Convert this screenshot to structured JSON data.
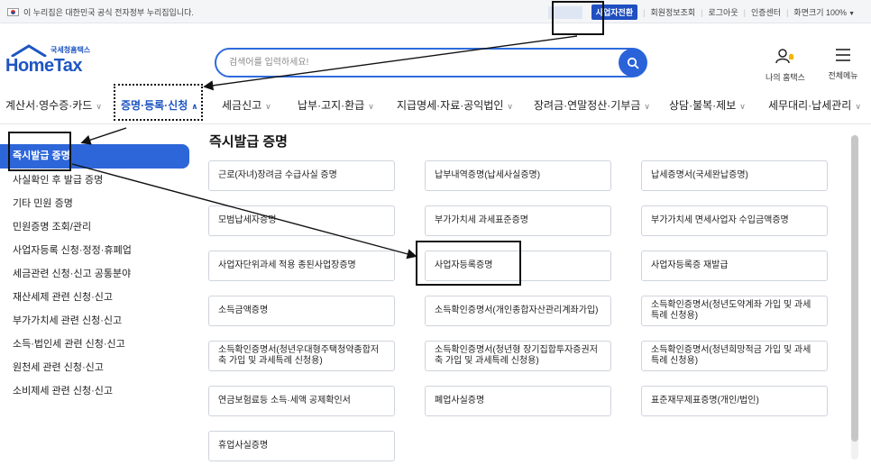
{
  "topbar": {
    "gov_notice": "이 누리집은 대한민국 공식 전자정부 누리집입니다.",
    "links": {
      "business": "사업자전환",
      "member_info": "회원정보조회",
      "logout": "로그아웃",
      "cert_center": "인증센터",
      "screen_size": "화면크기 100%"
    }
  },
  "header": {
    "logo_small": "국세청홈택스",
    "logo_big": "HomeTax",
    "search_placeholder": "검색어를 입력하세요!",
    "my_home": "나의 홈택스",
    "all_menu": "전체메뉴"
  },
  "nav": {
    "items": [
      "계산서·영수증·카드",
      "증명·등록·신청",
      "세금신고",
      "납부·고지·환급",
      "지급명세·자료·공익법인",
      "장려금·연말정산·기부금",
      "상담·불복·제보",
      "세무대리·납세관리"
    ]
  },
  "sidebar": {
    "items": [
      "즉시발급 증명",
      "사실확인 후 발급 증명",
      "기타 민원 증명",
      "민원증명 조회/관리",
      "사업자등록 신청·정정·휴폐업",
      "세금관련 신청·신고 공통분야",
      "재산세제 관련 신청·신고",
      "부가가치세 관련 신청·신고",
      "소득·법인세 관련 신청·신고",
      "원천세 관련 신청·신고",
      "소비제세 관련 신청·신고"
    ]
  },
  "main": {
    "title": "즉시발급 증명",
    "cards": [
      "근로(자녀)장려금 수급사실 증명",
      "납부내역증명(납세사실증명)",
      "납세증명서(국세완납증명)",
      "모범납세자증명",
      "부가가치세 과세표준증명",
      "부가가치세 면세사업자 수입금액증명",
      "사업자단위과세 적용 종된사업장증명",
      "사업자등록증명",
      "사업자등록증 재발급",
      "소득금액증명",
      "소득확인증명서(개인종합자산관리계좌가입)",
      "소득확인증명서(청년도약계좌 가입 및 과세특례 신청용)",
      "소득확인증명서(청년우대형주택청약종합저축 가입 및 과세특례 신청용)",
      "소득확인증명서(청년형 장기집합투자증권저축 가입 및 과세특례 신청용)",
      "소득확인증명서(청년희망적금 가입 및 과세특례 신청용)",
      "연금보험료등 소득·세액 공제확인서",
      "폐업사실증명",
      "표준재무제표증명(개인/법인)",
      "휴업사실증명"
    ]
  },
  "colors": {
    "brand_blue": "#1d55c2",
    "active_bg": "#2d66d8",
    "annotation": "#111111"
  }
}
